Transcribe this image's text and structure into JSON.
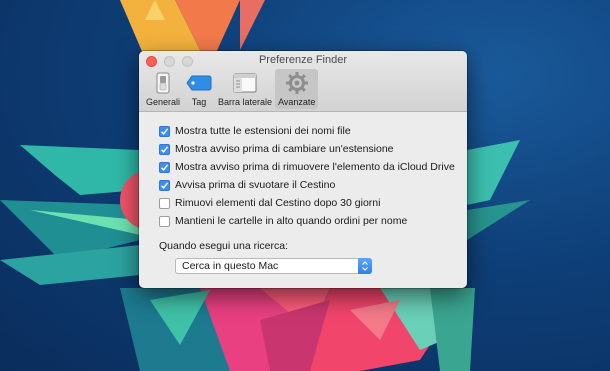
{
  "window": {
    "title": "Preferenze Finder",
    "tabs": [
      {
        "label": "Generali",
        "icon": "switch-icon",
        "active": false
      },
      {
        "label": "Tag",
        "icon": "tag-icon",
        "active": false
      },
      {
        "label": "Barra laterale",
        "icon": "sidebar-icon",
        "active": false
      },
      {
        "label": "Avanzate",
        "icon": "gear-icon",
        "active": true
      }
    ]
  },
  "options": [
    {
      "label": "Mostra tutte le estensioni dei nomi file",
      "checked": true
    },
    {
      "label": "Mostra avviso prima di cambiare un'estensione",
      "checked": true
    },
    {
      "label": "Mostra avviso prima di rimuovere l'elemento da iCloud Drive",
      "checked": true
    },
    {
      "label": "Avvisa prima di svuotare il Cestino",
      "checked": true
    },
    {
      "label": "Rimuovi elementi dal Cestino dopo 30 giorni",
      "checked": false
    },
    {
      "label": "Mantieni le cartelle in alto quando ordini per nome",
      "checked": false
    }
  ],
  "search": {
    "label": "Quando esegui una ricerca:",
    "selected": "Cerca in questo Mac"
  },
  "colors": {
    "accent": "#3b8ff0",
    "close": "#fc5f57",
    "background": "#0e3f78"
  }
}
